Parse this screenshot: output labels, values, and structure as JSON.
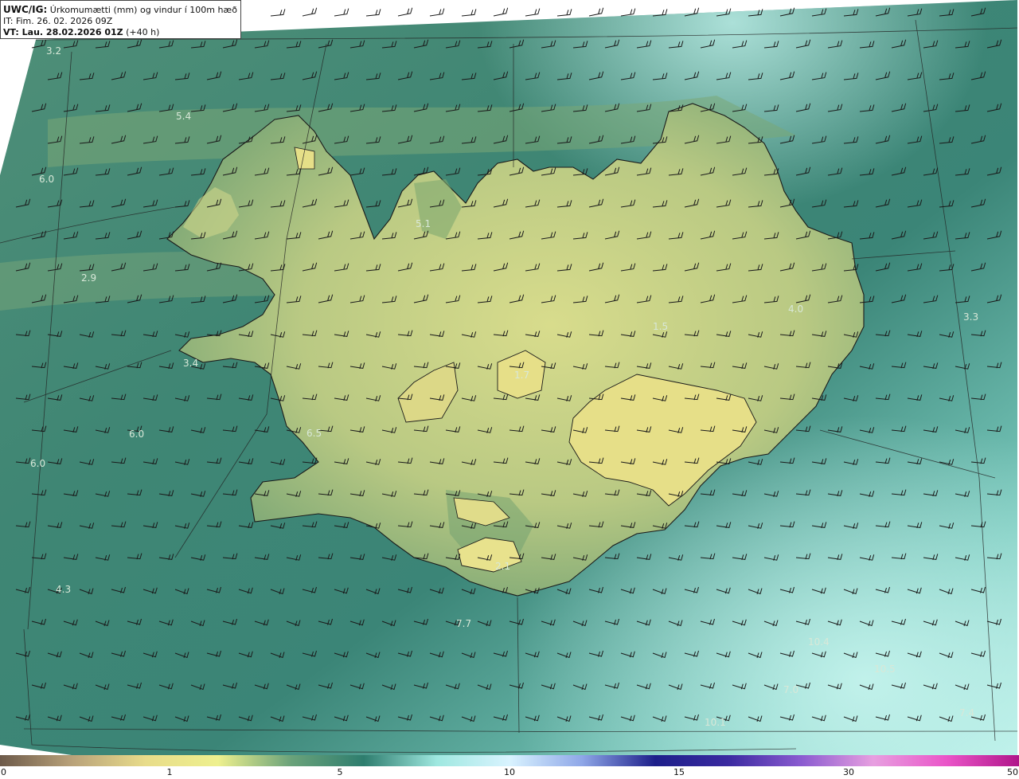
{
  "header": {
    "product": "UWC/IG:",
    "title": " Úrkomumætti (mm) og vindur í 100m hæð",
    "it_line": "IT: Fim. 26. 02. 2026 09Z",
    "vt_label": "VT: Lau. 28.02.2026 01Z",
    "vt_lead": " (+40 h)"
  },
  "map_labels": [
    "3.2",
    "5.4",
    "6.0",
    "5.1",
    "2.9",
    "4.0",
    "3.3",
    "1.5",
    "1.7",
    "3.4",
    "6.5",
    "6.0",
    "6.0",
    "4.3",
    "2.1",
    "7.7",
    "10.4",
    "7.0",
    "10.1",
    "7.4",
    "10.5"
  ],
  "colorbar": {
    "tick_labels": [
      "0",
      "1",
      "5",
      "10",
      "15",
      "30",
      "50"
    ],
    "colors": [
      "#6d5a4a",
      "#b9a27a",
      "#e8dc8a",
      "#eef08e",
      "#6aa27a",
      "#2e7d6e",
      "#9fe8e0",
      "#d9f3ff",
      "#8fa7e8",
      "#1d1f8a",
      "#3a2aa0",
      "#8a5bd0",
      "#e79fe0",
      "#ea55c8",
      "#b0168a"
    ]
  },
  "colors": {
    "sea_dark": "#2e6f65",
    "sea_light": "#a8e6df",
    "land_yellow": "#d4d98a",
    "land_green": "#7fa470",
    "outline": "#1a1a1a"
  }
}
